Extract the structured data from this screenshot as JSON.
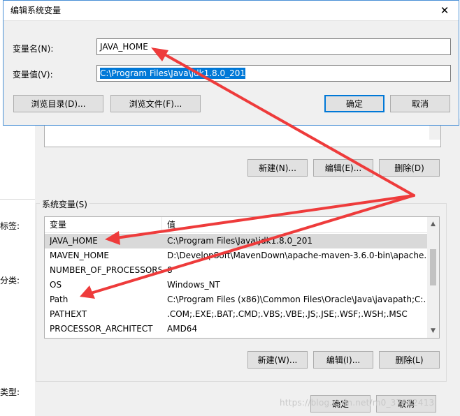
{
  "edit_dialog": {
    "title": "编辑系统变量",
    "name_label": "变量名(N):",
    "name_value": "JAVA_HOME",
    "value_label": "变量值(V):",
    "value_value": "C:\\Program Files\\Java\\jdk1.8.0_201",
    "browse_dir_label": "浏览目录(D)...",
    "browse_file_label": "浏览文件(F)...",
    "ok_label": "确定",
    "cancel_label": "取消"
  },
  "background": {
    "left_labels": [
      "标签:",
      "分类:",
      "类型:"
    ],
    "user_vars": {
      "new_label": "新建(N)...",
      "edit_label": "编辑(E)...",
      "delete_label": "删除(D)"
    },
    "system_vars": {
      "group_title": "系统变量(S)",
      "columns": [
        "变量",
        "值"
      ],
      "rows": [
        {
          "name": "JAVA_HOME",
          "value": "C:\\Program Files\\Java\\jdk1.8.0_201"
        },
        {
          "name": "MAVEN_HOME",
          "value": "D:\\DevelopSoft\\MavenDown\\apache-maven-3.6.0-bin\\apache..."
        },
        {
          "name": "NUMBER_OF_PROCESSORS",
          "value": "8"
        },
        {
          "name": "OS",
          "value": "Windows_NT"
        },
        {
          "name": "Path",
          "value": "C:\\Program Files (x86)\\Common Files\\Oracle\\Java\\javapath;C:..."
        },
        {
          "name": "PATHEXT",
          "value": ".COM;.EXE;.BAT;.CMD;.VBS;.VBE;.JS;.JSE;.WSF;.WSH;.MSC"
        },
        {
          "name": "PROCESSOR_ARCHITECT",
          "value": "AMD64"
        }
      ],
      "new_label": "新建(W)...",
      "edit_label": "编辑(I)...",
      "delete_label": "删除(L)"
    },
    "ok_label": "确定",
    "cancel_label": "取消"
  },
  "watermark": "https://blog.csdn.net/m0_37072413",
  "colors": {
    "accent": "#0078d7",
    "annotation_arrow": "#ee3b3b"
  }
}
